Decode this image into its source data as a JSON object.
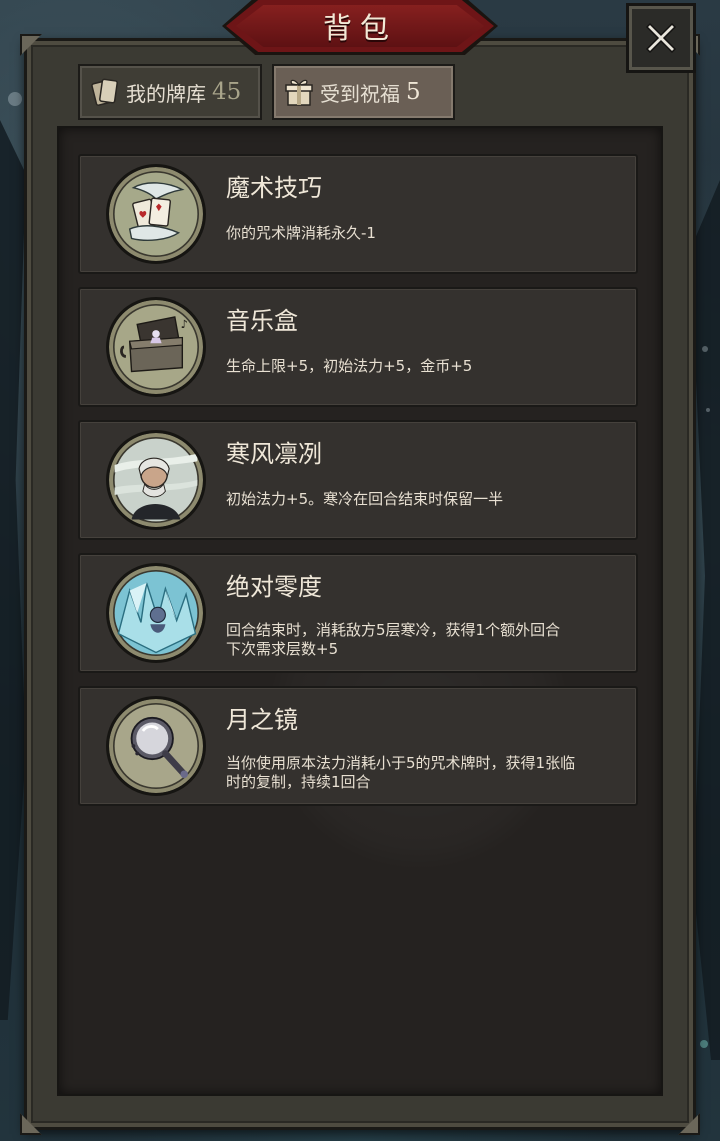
{
  "header": {
    "title": "背包",
    "close_icon": "close-x-icon"
  },
  "tabs": [
    {
      "label": "我的牌库",
      "count": "45",
      "icon": "card-icon",
      "active": false
    },
    {
      "label": "受到祝福",
      "count": "5",
      "icon": "gift-icon",
      "active": true
    }
  ],
  "blessings": [
    {
      "name": "魔术技巧",
      "desc": "你的咒术牌消耗永久-1",
      "icon": "magic-trick-icon"
    },
    {
      "name": "音乐盒",
      "desc": "生命上限+5，初始法力+5，金币+5",
      "icon": "music-box-icon"
    },
    {
      "name": "寒风凛冽",
      "desc": "初始法力+5。寒冷在回合结束时保留一半",
      "icon": "cold-wind-icon"
    },
    {
      "name": "绝对零度",
      "desc": "回合结束时，消耗敌方5层寒冷，获得1个额外回合\n下次需求层数+5",
      "desc_line1": "回合结束时，消耗敌方5层寒冷，获得1个额外回合",
      "desc_line2": "下次需求层数+5",
      "icon": "absolute-zero-icon"
    },
    {
      "name": "月之镜",
      "desc": "当你使用原本法力消耗小于5的咒术牌时，获得1张临时的复制，持续1回合",
      "desc_line1": "当你使用原本法力消耗小于5的咒术牌时，获得1张临",
      "desc_line2": "时的复制，持续1回合",
      "icon": "moon-mirror-icon"
    }
  ],
  "colors": {
    "banner": "#6e1517",
    "panel": "#3b3a33",
    "list_bg": "#252220",
    "item_bg": "#34312e",
    "active_tab": "#6a5f55"
  }
}
